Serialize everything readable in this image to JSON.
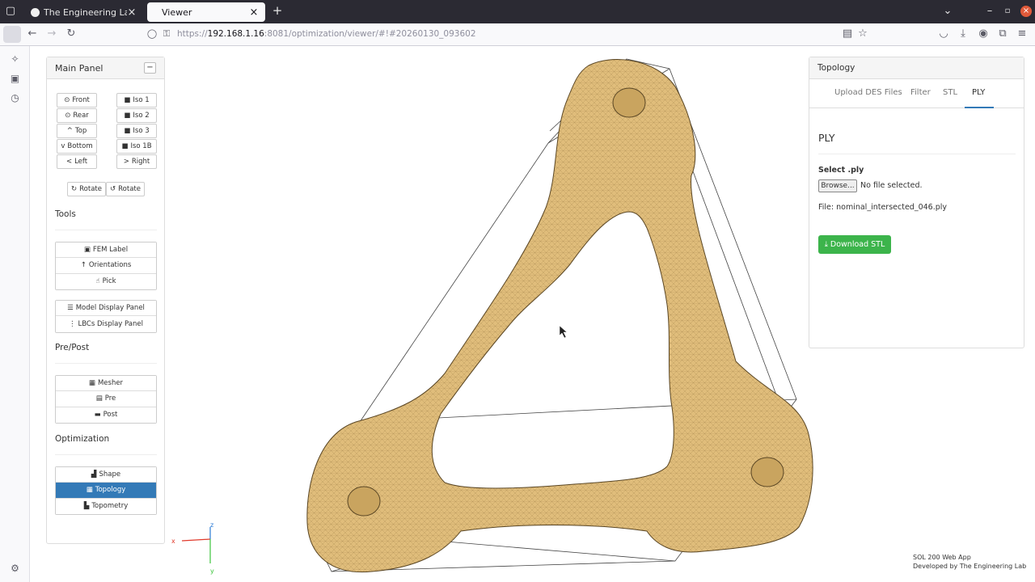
{
  "browser": {
    "tabs": [
      {
        "title": "The Engineering Lab | Na"
      },
      {
        "title": "Viewer"
      }
    ],
    "new_tab": "+",
    "url_scheme": "https://",
    "url_host": "192.168.1.16",
    "url_rest": ":8081/optimization/viewer/#!#20260130_093602"
  },
  "main_panel": {
    "title": "Main Panel",
    "minimize": "−",
    "view_buttons_left": [
      {
        "label": "Front",
        "icon": "⊙"
      },
      {
        "label": "Rear",
        "icon": "⊙"
      },
      {
        "label": "Top",
        "icon": "^"
      },
      {
        "label": "Bottom",
        "icon": "v"
      },
      {
        "label": "Left",
        "icon": "<"
      }
    ],
    "view_buttons_right": [
      {
        "label": "Iso 1",
        "icon": "■"
      },
      {
        "label": "Iso 2",
        "icon": "■"
      },
      {
        "label": "Iso 3",
        "icon": "■"
      },
      {
        "label": "Iso 1B",
        "icon": "■"
      },
      {
        "label": "Right",
        "icon": ">"
      }
    ],
    "rotate_buttons": [
      {
        "label": "Rotate",
        "icon": "↻"
      },
      {
        "label": "Rotate",
        "icon": "↺"
      }
    ],
    "tools_title": "Tools",
    "tools": [
      {
        "label": "FEM Label",
        "icon": "▣"
      },
      {
        "label": "Orientations",
        "icon": "↑"
      },
      {
        "label": "Pick",
        "icon": "☝"
      }
    ],
    "display": [
      {
        "label": "Model Display Panel",
        "icon": "☰"
      },
      {
        "label": "LBCs Display Panel",
        "icon": "⋮"
      }
    ],
    "prepost_title": "Pre/Post",
    "prepost": [
      {
        "label": "Mesher",
        "icon": "▦"
      },
      {
        "label": "Pre",
        "icon": "▤"
      },
      {
        "label": "Post",
        "icon": "▬"
      }
    ],
    "optimization_title": "Optimization",
    "optimization": [
      {
        "label": "Shape",
        "icon": "▟"
      },
      {
        "label": "Topology",
        "icon": "▦"
      },
      {
        "label": "Topometry",
        "icon": "▙"
      }
    ]
  },
  "topology_panel": {
    "title": "Topology",
    "tabs": [
      "Upload DES Files",
      "Filter",
      "STL",
      "PLY"
    ],
    "active_tab": "PLY",
    "heading": "PLY",
    "select_label": "Select .ply",
    "browse_button": "Browse...",
    "no_file": "No file selected.",
    "file_info": "File: nominal_intersected_046.ply",
    "download_button": "Download STL",
    "accent": "#337ab7",
    "download_color": "#3cb44b"
  },
  "axes": {
    "x": "x",
    "y": "y",
    "z": "z"
  },
  "footer": {
    "line1": "SOL 200 Web App",
    "line2": "Developed by The Engineering Lab"
  }
}
